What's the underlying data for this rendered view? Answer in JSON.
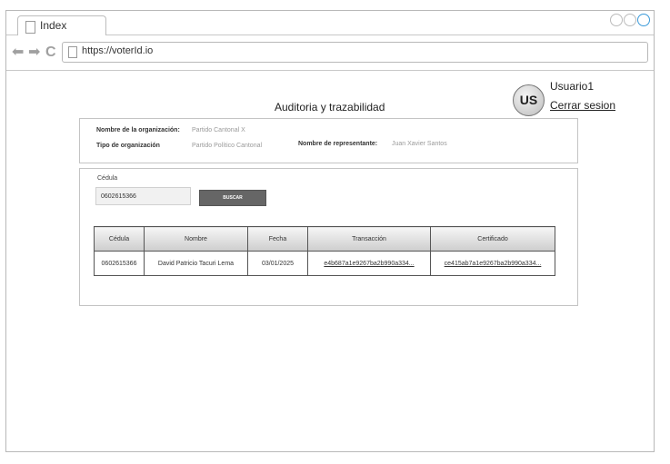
{
  "browser": {
    "tab_label": "Index",
    "url": "https://voterId.io"
  },
  "user": {
    "avatar_initials": "US",
    "name": "Usuario1",
    "logout_label": "Cerrar sesion"
  },
  "page": {
    "title": "Auditoria y trazabilidad"
  },
  "organization": {
    "name_label": "Nombre de la organización:",
    "name_value": "Partido Cantonal X",
    "type_label": "Tipo de organización",
    "type_value": "Partido Político Cantonal",
    "rep_label": "Nombre de representante:",
    "rep_value": "Juan Xavier Santos"
  },
  "search": {
    "cedula_label": "Cédula",
    "cedula_value": "0602615366",
    "button_label": "BUSCAR"
  },
  "table": {
    "headers": [
      "Cédula",
      "Nombre",
      "Fecha",
      "Transacción",
      "Certificado"
    ],
    "rows": [
      [
        "0602615366",
        "David Patricio Tacuri Lema",
        "03/01/2025",
        "e4b687a1e9267ba2b990a334...",
        "ce415ab7a1e9267ba2b990a334..."
      ]
    ]
  }
}
